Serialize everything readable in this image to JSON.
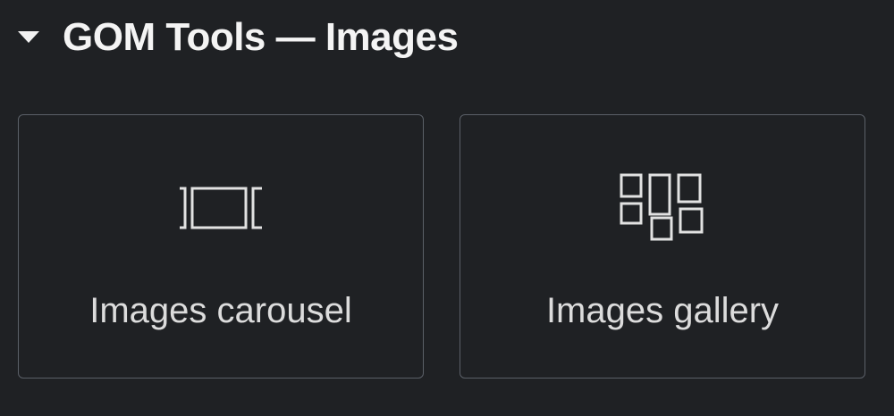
{
  "panel": {
    "title": "GOM Tools — Images",
    "caret_icon": "caret-down-icon"
  },
  "widgets": [
    {
      "label": "Images carousel",
      "icon": "carousel-icon"
    },
    {
      "label": "Images gallery",
      "icon": "gallery-icon"
    }
  ],
  "colors": {
    "background": "#1f2124",
    "card_border": "#5b6068",
    "text": "#dcdcdc"
  }
}
